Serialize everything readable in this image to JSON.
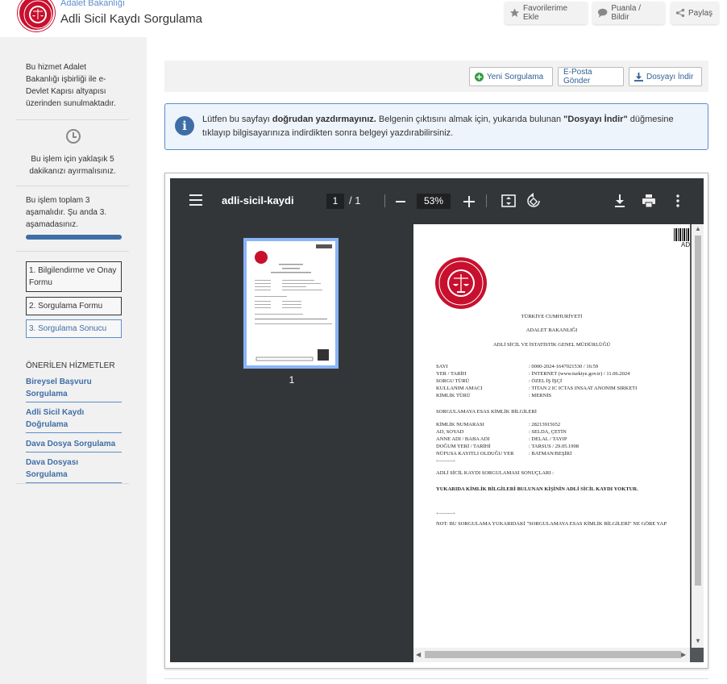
{
  "header": {
    "subtitle": "Adalet Bakanlığı",
    "title": "Adli Sicil Kaydı Sorgulama",
    "buttons": {
      "favorites": "Favorilerime Ekle",
      "rate": "Puanla / Bildir",
      "share": "Paylaş"
    },
    "colors": {
      "brand": "#c8102e",
      "accent": "#3f6ea6"
    }
  },
  "sidebar": {
    "intro": "Bu hizmet Adalet Bakanlığı işbirliği ile e-Devlet Kapısı altyapısı üzerinden sunulmaktadır.",
    "time_text": "Bu işlem için yaklaşık 5 dakikanızı ayırmalısınız.",
    "stages_text": "Bu işlem toplam 3 aşamalıdır. Şu anda 3. aşamadasınız.",
    "progress_fraction": 1.0,
    "steps": [
      {
        "label": "1. Bilgilendirme ve Onay Formu"
      },
      {
        "label": "2. Sorgulama Formu"
      },
      {
        "label": "3. Sorgulama Sonucu"
      }
    ],
    "recommended_title": "ÖNERİLEN HİZMETLER",
    "recommended": [
      {
        "label": "Bireysel Başvuru Sorgulama"
      },
      {
        "label": "Adli Sicil Kaydı Doğrulama"
      },
      {
        "label": "Dava Dosya Sorgulama"
      },
      {
        "label": "Dava Dosyası Sorgulama"
      }
    ]
  },
  "toolbar": {
    "new_query": "Yeni Sorgulama",
    "email": "E-Posta Gönder",
    "download": "Dosyayı İndir"
  },
  "info": {
    "icon": "i",
    "text_a": "Lütfen bu sayfayı ",
    "text_b": "doğrudan yazdırmayınız.",
    "text_c": " Belgenin çıktısını almak için, yukarıda bulunan ",
    "text_d": "\"Dosyayı İndir\"",
    "text_e": " düğmesine tıklayıp bilgisayarınıza indirdikten sonra belgeyi yazdırabilirsiniz."
  },
  "pdf": {
    "file_name": "adli-sicil-kaydi",
    "page_current": "1",
    "page_total": "/  1",
    "zoom": "53%",
    "thumb_number": "1",
    "doc": {
      "corner": "AD",
      "l1": "TÜRKİYE CUMHURİYETİ",
      "l2": "ADALET BAKANLIĞI",
      "l3": "ADLİ SİCİL VE İSTATİSTİK GENEL MÜDÜRLÜĞÜ",
      "rows1": [
        {
          "k": "SAYI",
          "v": ": 0000-2024-1647021530 / 16:59"
        },
        {
          "k": "YER / TARİH",
          "v": ": İNTERNET (www.turkiye.gov.tr) / 11.06.2024"
        },
        {
          "k": "SORGU TÜRÜ",
          "v": ": ÖZEL İŞ İŞÇİ"
        },
        {
          "k": "KULLANIM AMACI",
          "v": ": TITAN 2 IC ICTAS INSAAT ANONIM SIRKETI"
        },
        {
          "k": "KİMLİK TÜRÜ",
          "v": ": MERNİS"
        }
      ],
      "section1": "SORGULAMAYA ESAS KİMLİK BİLGİLERİ",
      "rows2": [
        {
          "k": "KİMLİK NUMARASI",
          "v": ": 28213915652"
        },
        {
          "k": "AD, SOYAD",
          "v": ": SELDA, ÇETİN"
        },
        {
          "k": "ANNE ADI / BABA ADI",
          "v": ": DELAL / TAYIP"
        },
        {
          "k": "DOĞUM YERİ / TARİHİ",
          "v": ": TARSUS / 29.05.1998"
        },
        {
          "k": "NÜFUSA KAYITLI OLDUĞU YER",
          "v": ": BATMAN/BEŞİRİ"
        }
      ],
      "divider": "+-----------+",
      "section2": "ADLİ SİCİL KAYDI SORGULAMASI SONUÇLARI :",
      "result": "YUKARIDA KİMLİK BİLGİLERİ BULUNAN KİŞİNİN ADLİ SİCİL KAYDI YOKTUR.",
      "divider2": "+-----------+",
      "note": "NOT: BU SORGULAMA YUKARIDAKİ \"SORGULAMAYA ESAS KİMLİK BİLGİLERİ\" NE GÖRE YAP"
    }
  }
}
